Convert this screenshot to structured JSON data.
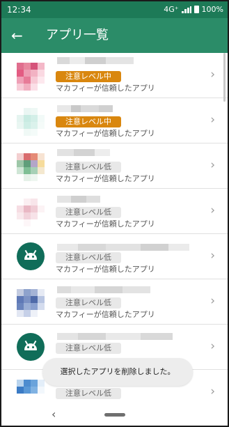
{
  "status_bar": {
    "time": "12:34",
    "network": "4G⁺",
    "battery": "100%"
  },
  "app_bar": {
    "title": "アプリ一覧"
  },
  "apps": [
    {
      "level": "注意レベル中",
      "level_kind": "mid",
      "trust": "マカフィーが信頼したアプリ",
      "icon": "blurred-app-icon"
    },
    {
      "level": "注意レベル中",
      "level_kind": "mid",
      "trust": "マカフィーが信頼したアプリ",
      "icon": "blurred-app-icon"
    },
    {
      "level": "注意レベル低",
      "level_kind": "low",
      "trust": "マカフィーが信頼したアプリ",
      "icon": "blurred-app-icon"
    },
    {
      "level": "注意レベル低",
      "level_kind": "low",
      "trust": "マカフィーが信頼したアプリ",
      "icon": "blurred-app-icon"
    },
    {
      "level": "注意レベル低",
      "level_kind": "low",
      "trust": "マカフィーが信頼したアプリ",
      "icon": "android-icon"
    },
    {
      "level": "注意レベル低",
      "level_kind": "low",
      "trust": "マカフィーが信頼したアプリ",
      "icon": "blurred-app-icon"
    },
    {
      "level": "注意レベル低",
      "level_kind": "low",
      "trust": "",
      "icon": "android-icon"
    },
    {
      "level": "注意レベル低",
      "level_kind": "low",
      "trust": "",
      "icon": "blurred-app-icon"
    }
  ],
  "toast": "選択したアプリを削除しました。",
  "colors": {
    "status_bar": "#1d7a57",
    "app_bar": "#2b8c68",
    "badge_mid": "#d9870f",
    "badge_low": "#e8e8e8"
  }
}
